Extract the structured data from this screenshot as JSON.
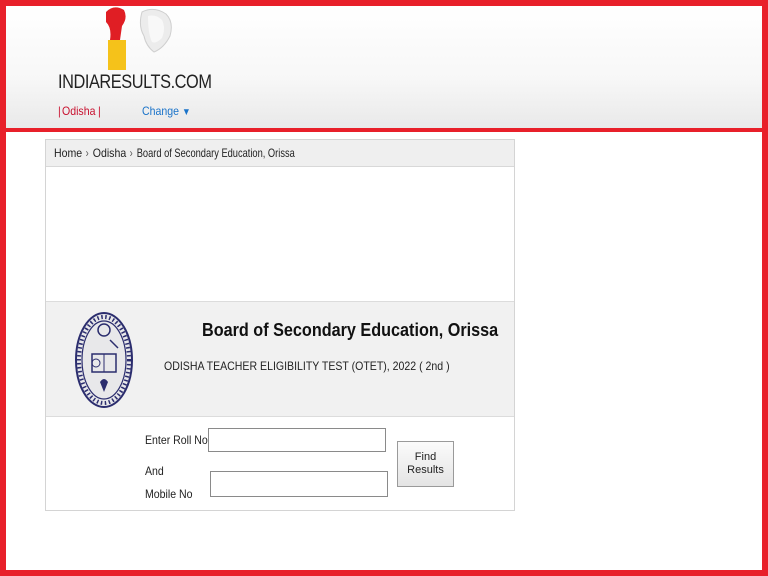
{
  "site": {
    "logo_text": "INDIARESULTS.COM",
    "state_separator_left": "|",
    "state": "Odisha",
    "state_separator_right": "|",
    "change_label": "Change",
    "change_icon": "triangle-down-icon"
  },
  "breadcrumb": {
    "items": [
      "Home",
      "Odisha",
      "Board of Secondary Education, Orissa"
    ],
    "separator": "›"
  },
  "organization": {
    "title": "Board of Secondary Education, Orissa",
    "exam": "ODISHA TEACHER ELIGIBILITY TEST (OTET), 2022 ( 2nd )"
  },
  "form": {
    "roll_label": "Enter Roll No",
    "and_label": "And",
    "mobile_label": "Mobile No",
    "roll_value": "",
    "mobile_value": "",
    "find_label_line1": "Find",
    "find_label_line2": "Results"
  },
  "colors": {
    "frame": "#e8202a",
    "link": "#1a73c9",
    "state": "#c8102e"
  }
}
